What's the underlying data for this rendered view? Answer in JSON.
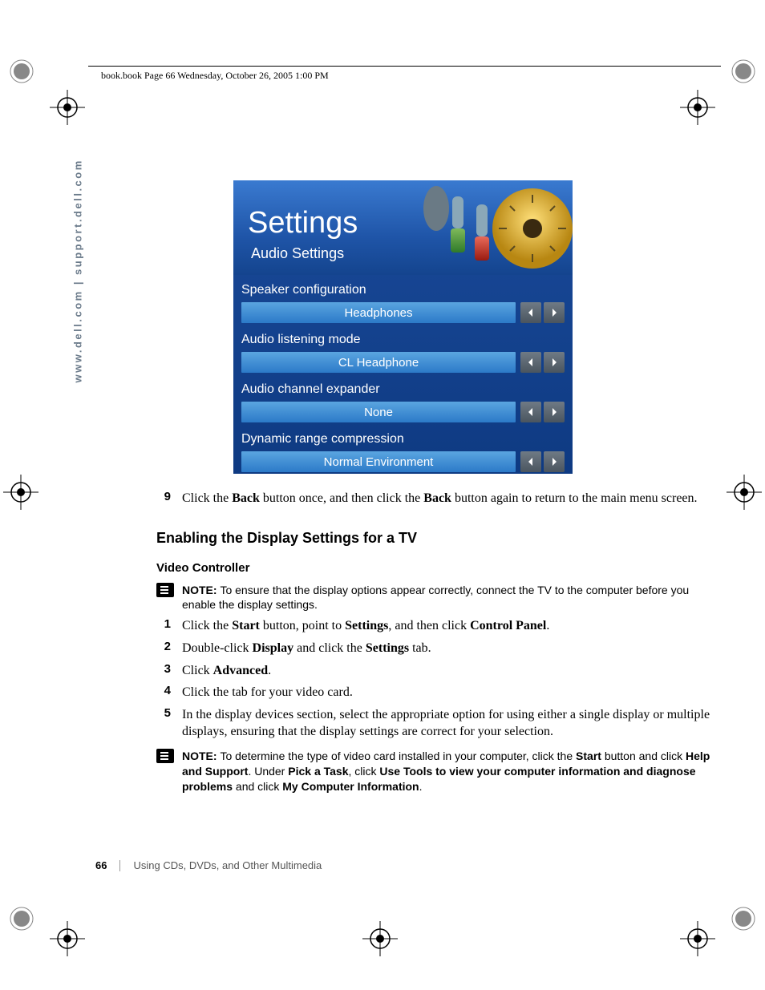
{
  "header": {
    "running_head": "book.book  Page 66  Wednesday, October 26, 2005  1:00 PM"
  },
  "sidebar": {
    "url_text": "www.dell.com | support.dell.com"
  },
  "settings_panel": {
    "title": "Settings",
    "subtitle": "Audio Settings",
    "groups": [
      {
        "label": "Speaker configuration",
        "value": "Headphones"
      },
      {
        "label": "Audio listening mode",
        "value": "CL Headphone"
      },
      {
        "label": "Audio channel expander",
        "value": "None"
      },
      {
        "label": "Dynamic range compression",
        "value": "Normal Environment"
      }
    ]
  },
  "step9": {
    "num": "9",
    "pre": "Click the ",
    "b1": "Back",
    "mid": " button once, and then click the ",
    "b2": "Back",
    "post": " button again to return to the main menu screen."
  },
  "heading1": "Enabling the Display Settings for a TV",
  "subheading1": "Video Controller",
  "note1": {
    "label": "NOTE: ",
    "text": "To ensure that the display options appear correctly, connect the TV to the computer before you enable the display settings."
  },
  "steps": [
    {
      "num": "1",
      "pre": "Click the ",
      "b1": "Start",
      "mid1": " button, point to ",
      "b2": "Settings",
      "mid2": ", and then click ",
      "b3": "Control Panel",
      "post": "."
    },
    {
      "num": "2",
      "pre": "Double-click ",
      "b1": "Display",
      "mid1": " and click the ",
      "b2": "Settings",
      "post": " tab."
    },
    {
      "num": "3",
      "pre": "Click ",
      "b1": "Advanced",
      "post": "."
    },
    {
      "num": "4",
      "text": "Click the tab for your video card."
    },
    {
      "num": "5",
      "text": "In the display devices section, select the appropriate option for using either a single display or multiple displays, ensuring that the display settings are correct for your selection."
    }
  ],
  "note2": {
    "label": "NOTE: ",
    "p1": "To determine the type of video card installed in your computer, click the ",
    "b1": "Start",
    "p2": " button and click ",
    "b2": "Help and Support",
    "p3": ". Under ",
    "b3": "Pick a Task",
    "p4": ", click ",
    "b4": "Use Tools to view your computer information and diagnose problems",
    "p5": " and click ",
    "b5": "My Computer Information",
    "p6": "."
  },
  "footer": {
    "page_num": "66",
    "chapter": "Using CDs, DVDs, and Other Multimedia"
  }
}
